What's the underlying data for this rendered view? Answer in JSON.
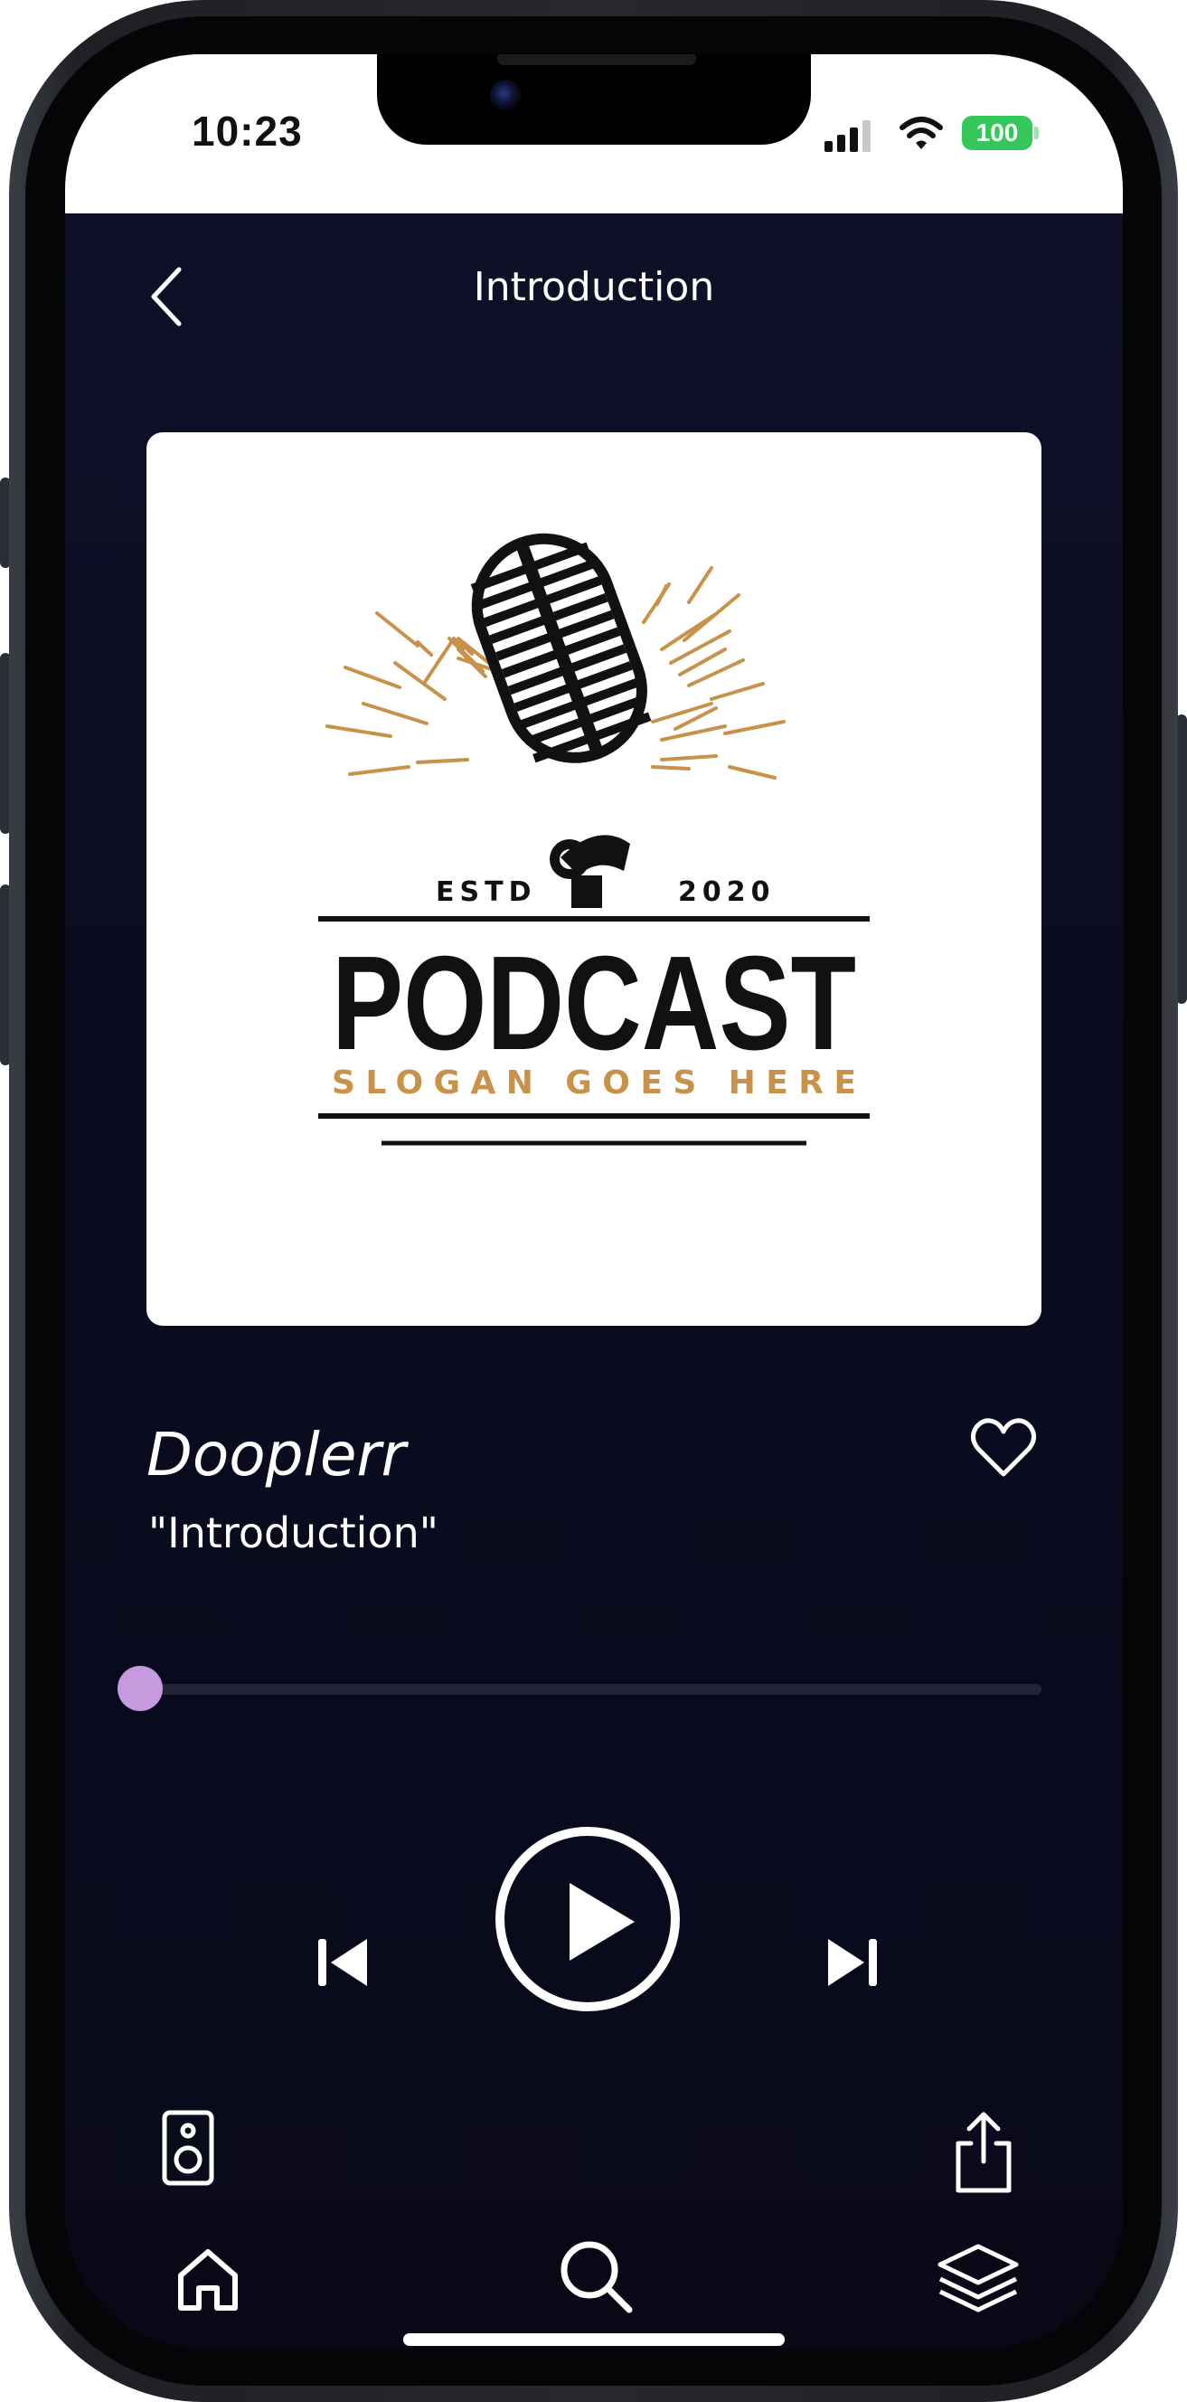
{
  "status_bar": {
    "time": "10:23",
    "battery": "100",
    "battery_color": "#34c759"
  },
  "header": {
    "title": "Introduction",
    "back_icon": "chevron-left-icon"
  },
  "artwork": {
    "estd_label": "ESTD",
    "year": "2020",
    "brand": "PODCAST",
    "slogan": "SLOGAN GOES HERE",
    "accent_color": "#c8924a"
  },
  "episode": {
    "show_name": "Dooplerr",
    "title": "\"Introduction\"",
    "favorite_icon": "heart-outline-icon"
  },
  "player": {
    "progress": 0.0,
    "accent_color": "#c79ae0",
    "controls": [
      "skip-previous-icon",
      "play-icon",
      "skip-next-icon"
    ]
  },
  "actions": {
    "left_icon": "speaker-icon",
    "right_icon": "share-icon"
  },
  "tab_bar": {
    "tabs": [
      "home-icon",
      "search-icon",
      "library-layers-icon"
    ]
  }
}
